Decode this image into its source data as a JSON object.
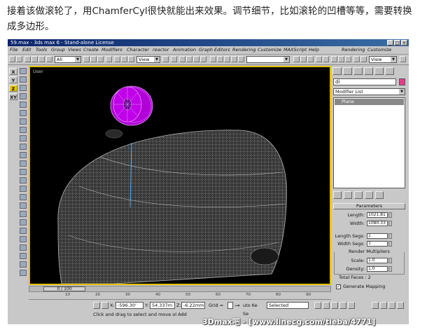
{
  "caption": "接着该做滚轮了，用ChamferCyl很快就能出来效果。调节细节，比如滚轮的凹槽等等，需要转换成多边形。",
  "window": {
    "title": "59.max - 3ds max 6 - Stand-alone License"
  },
  "menu": [
    "File",
    "Edit",
    "Tools",
    "Group",
    "Views",
    "Create",
    "Modifiers",
    "Character",
    "reactor",
    "Animation",
    "Graph Editors",
    "Rendering",
    "Customize",
    "MAXScript",
    "Help"
  ],
  "menu_right": [
    "Rendering",
    "Customize"
  ],
  "toolbar": {
    "selection_filter": "All",
    "ref_coord": "View",
    "view_right": "View"
  },
  "axis_buttons": [
    "Y",
    "Z",
    "XY"
  ],
  "viewport": {
    "label": "User"
  },
  "command_panel": {
    "object_name": "di",
    "modifier_list": "Modifier List",
    "stack_item": "Plane",
    "rollout_title": "Parameters",
    "length_label": "Length:",
    "length_value": "1021.81",
    "width_label": "Width:",
    "width_value": "1080.33",
    "length_segs_label": "Length Segs:",
    "length_segs_value": "1",
    "width_segs_label": "Width Segs:",
    "width_segs_value": "1",
    "render_multipliers_title": "Render Multipliers",
    "scale_label": "Scale:",
    "scale_value": "1.0",
    "density_label": "Density:",
    "density_value": "1.0",
    "total_faces": "Total Faces : 2",
    "generate_mapping": "Generate Mapping"
  },
  "time": {
    "slider": "0 / 100",
    "ticks": [
      "10",
      "20",
      "30",
      "40",
      "50",
      "60",
      "70",
      "80",
      "90"
    ]
  },
  "status": {
    "x_label": "X:",
    "x_value": "-596.30'",
    "y_label": "Y:",
    "y_value": "54.337m",
    "z_label": "Z:",
    "z_value": "-6.22mm",
    "grid_label": "Grid =",
    "autokey": "uto Ke",
    "selected": "Selected",
    "set_key": "Se",
    "prompt": "Click and drag to select and move ol Add"
  },
  "watermark": "3Dmax吧 - [www.linecg.com/tieba/4771]",
  "colors": {
    "viewport_bg": "#000000",
    "wireframe": "#9a9a9a",
    "wheel": "#b100d8",
    "active_border": "#e0c000",
    "ui_gray": "#c8c8c8"
  }
}
